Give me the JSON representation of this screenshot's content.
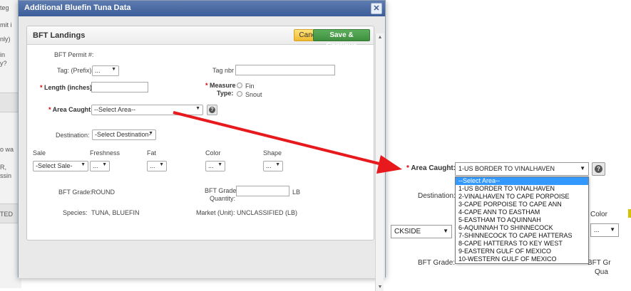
{
  "background": {
    "fragments": [
      "teg",
      "mit i",
      "nly)",
      "in",
      "y?",
      "o wa",
      "R,",
      "ssin",
      "TED"
    ]
  },
  "modal": {
    "title": "Additional Bluefin Tuna Data",
    "close_glyph": "✕"
  },
  "panel": {
    "title": "BFT Landings",
    "cancel_label": "Cancel",
    "save_label": "Save & Continue"
  },
  "form": {
    "permit_label": "BFT Permit #:",
    "tag_prefix_label": "Tag: (Prefix)",
    "tag_prefix_value": "...",
    "tag_nbr_label": "Tag nbr",
    "length_label": "Length (inches):",
    "measure_label_1": "Measure",
    "measure_label_2": "Type:",
    "measure_options": [
      "Fin",
      "Snout"
    ],
    "area_label": "Area Caught:",
    "area_value": "--Select Area--",
    "destination_label": "Destination:",
    "destination_value": "-Select Destination-",
    "sale_label": "Sale",
    "sale_value": "-Select Sale-",
    "freshness_label": "Freshness",
    "freshness_value": "...",
    "fat_label": "Fat",
    "fat_value": "...",
    "color_label": "Color",
    "color_value": "...",
    "shape_label": "Shape",
    "shape_value": "...",
    "grade_label": "BFT Grade:",
    "grade_value": "ROUND",
    "grade_qty_label_1": "BFT Grade",
    "grade_qty_label_2": "Quantity:",
    "grade_qty_unit": "LB",
    "species_label": "Species:",
    "species_value": "TUNA, BLUEFIN",
    "market_label": "Market (Unit):",
    "market_value": "UNCLASSIFIED (LB)"
  },
  "zoom": {
    "area_label": "Area Caught:",
    "area_value": "1-US BORDER TO VINALHAVEN",
    "destination_label": "Destination:",
    "partial_select_value": "CKSIDE",
    "color_label": "Color",
    "color_value": "...",
    "grade_label": "BFT Grade:",
    "grade_right_1": "BFT Gr",
    "grade_right_2": "Qua",
    "options": [
      "--Select Area--",
      "1-US BORDER TO VINALHAVEN",
      "2-VINALHAVEN TO CAPE PORPOISE",
      "3-CAPE PORPOISE TO CAPE ANN",
      "4-CAPE ANN TO EASTHAM",
      "5-EASTHAM TO AQUINNAH",
      "6-AQUINNAH TO SHINNECOCK",
      "7-SHINNECOCK TO CAPE HATTERAS",
      "8-CAPE HATTERAS TO KEY WEST",
      "9-EASTERN GULF OF MEXICO",
      "10-WESTERN GULF OF MEXICO"
    ],
    "highlighted_index": 0
  },
  "colors": {
    "arrow": "#e8191c",
    "highlight": "#3399ff",
    "save_button": "#3e8e3e",
    "cancel_button": "#f0b82e",
    "titlebar": "#3c5d98"
  }
}
